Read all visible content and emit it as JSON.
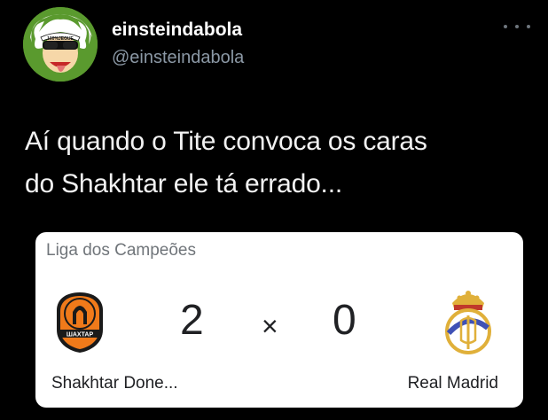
{
  "tweet": {
    "display_name": "einsteindabola",
    "handle": "@einsteindabola",
    "text_lines": [
      "Aí quando o Tite convoca os caras",
      "do Shakhtar ele tá errado..."
    ],
    "avatar_icon": "einstein-caricature-icon",
    "avatar_badge_text": "100%JEGUE",
    "more_icon": "more-options-icon"
  },
  "score_card": {
    "league": "Liga dos Campeões",
    "home": {
      "name": "Shakhtar Done...",
      "score": "2",
      "crest_icon": "shakhtar-crest-icon",
      "crest_text": "ШАХТАР"
    },
    "separator": "×",
    "away": {
      "name": "Real Madrid",
      "score": "0",
      "crest_icon": "real-madrid-crest-icon"
    }
  },
  "colors": {
    "background": "#000000",
    "name": "#ffffff",
    "handle": "#8b98a5",
    "card": "#ffffff",
    "shakhtar_orange": "#f07a1a",
    "real_madrid_gold": "#e0b03a"
  }
}
